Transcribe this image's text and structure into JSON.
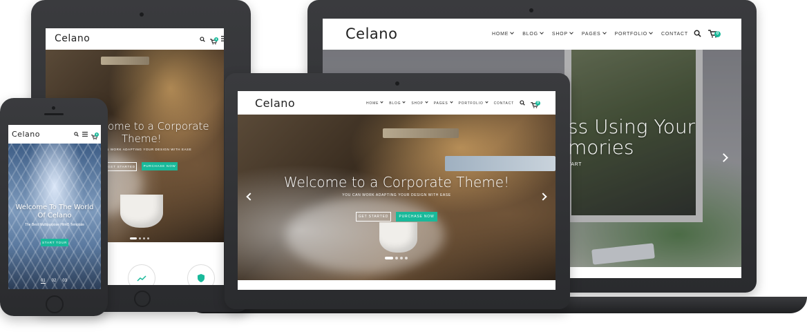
{
  "brand": "Celano",
  "nav": {
    "home": "HOME",
    "blog": "BLOG",
    "shop": "SHOP",
    "pages": "PAGES",
    "portfolio": "PORTFOLIO",
    "contact": "CONTACT"
  },
  "cart_count": "0",
  "desktop": {
    "headline_line1": "ss Using Your",
    "headline_line2": "mories",
    "button_partial": "TART"
  },
  "laptop": {
    "headline": "Welcome to a Corporate Theme!",
    "subtitle": "YOU CAN WORK ADAPTING YOUR DESIGN WITH EASE",
    "get_started": "GET STARTED",
    "purchase": "PURCHASE NOW"
  },
  "tablet": {
    "headline_line1": "ome to a Corporate",
    "headline_line2": "Theme!",
    "subtitle": "N WORK ADAPTING YOUR DESIGN WITH EASE",
    "get_started": "GET STARTED",
    "purchase": "PURCHASE NOW"
  },
  "phone": {
    "headline_line1": "Welcome To The World",
    "headline_line2": "Of Celano",
    "subtitle": "The Best Multipurpose Html5 Template",
    "start": "START TOUR",
    "slides": [
      "01",
      "02",
      "03"
    ]
  },
  "colors": {
    "accent": "#19b99a",
    "device": "#2f3033",
    "text": "#222222"
  }
}
